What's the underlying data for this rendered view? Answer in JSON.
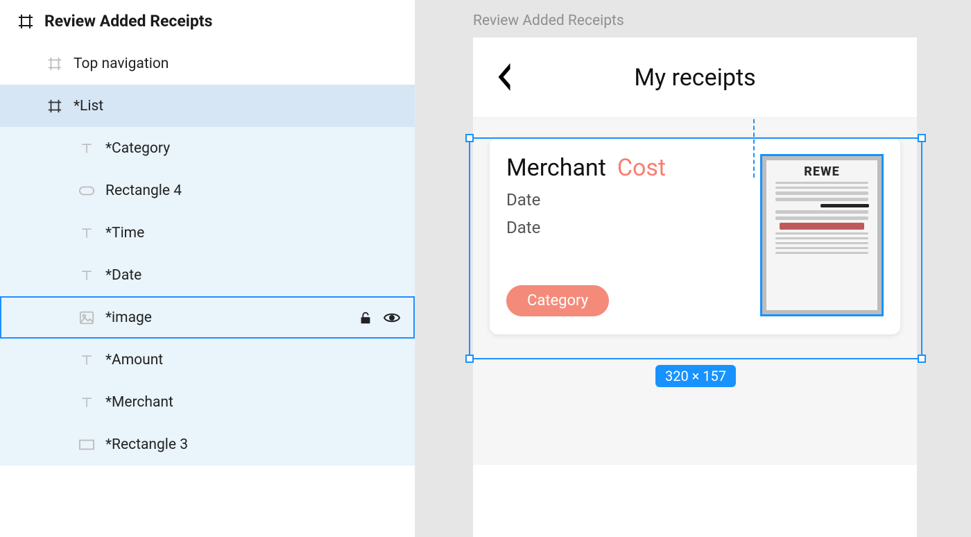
{
  "layers": {
    "root_title": "Review Added Receipts",
    "items": [
      {
        "label": "Top navigation"
      },
      {
        "label": "*List"
      },
      {
        "label": "*Category"
      },
      {
        "label": "Rectangle 4"
      },
      {
        "label": "*Time"
      },
      {
        "label": "*Date"
      },
      {
        "label": "*image"
      },
      {
        "label": "*Amount"
      },
      {
        "label": "*Merchant"
      },
      {
        "label": "*Rectangle 3"
      }
    ]
  },
  "canvas": {
    "frame_name": "Review Added Receipts",
    "selection_dimensions": "320 × 157"
  },
  "artboard": {
    "topnav_title": "My receipts",
    "card": {
      "merchant": "Merchant",
      "cost": "Cost",
      "date1": "Date",
      "date2": "Date",
      "category": "Category",
      "receipt_brand": "REWE"
    }
  }
}
